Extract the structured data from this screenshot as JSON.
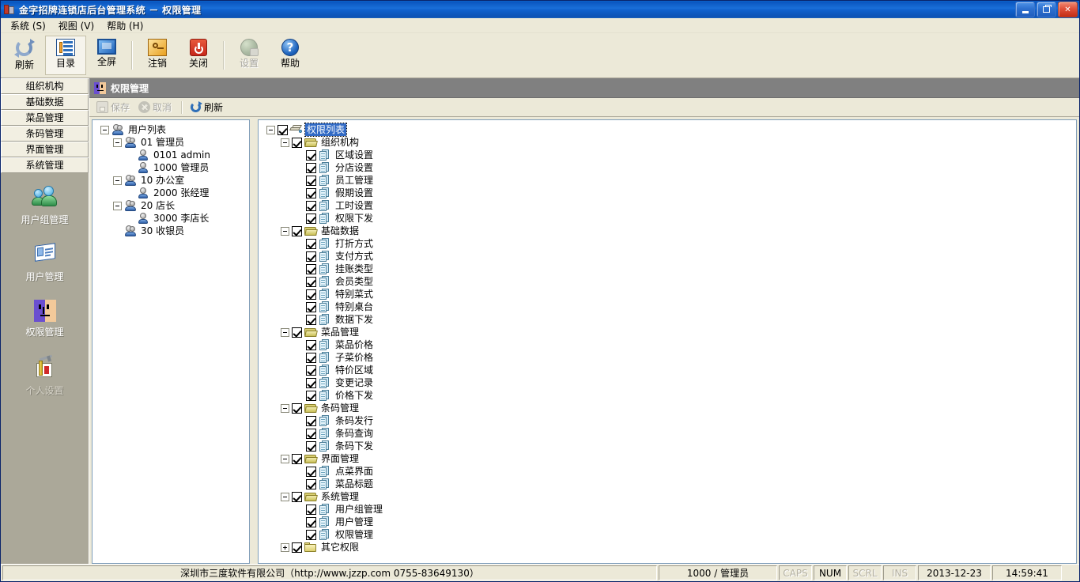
{
  "window": {
    "title": "金字招牌连锁店后台管理系统 － 权限管理",
    "icon": "app-database-icon",
    "minimize_label": "最小化",
    "restore_label": "还原",
    "close_label": "✕"
  },
  "menubar": {
    "items": [
      {
        "label": "系统 (S)"
      },
      {
        "label": "视图 (V)"
      },
      {
        "label": "帮助 (H)"
      }
    ]
  },
  "toolbar": {
    "buttons": [
      {
        "label": "刷新",
        "icon": "refresh-icon",
        "state": "normal"
      },
      {
        "label": "目录",
        "icon": "catalog-icon",
        "state": "active"
      },
      {
        "label": "全屏",
        "icon": "fullscreen-icon",
        "state": "normal"
      },
      {
        "label": "注销",
        "icon": "key-logout-icon",
        "state": "normal"
      },
      {
        "label": "关闭",
        "icon": "power-close-icon",
        "state": "normal"
      },
      {
        "label": "设置",
        "icon": "globe-settings-icon",
        "state": "disabled"
      },
      {
        "label": "帮助",
        "icon": "help-question-icon",
        "state": "normal"
      }
    ]
  },
  "sidebar": {
    "categories": [
      {
        "label": "组织机构"
      },
      {
        "label": "基础数据"
      },
      {
        "label": "菜品管理"
      },
      {
        "label": "条码管理"
      },
      {
        "label": "界面管理"
      },
      {
        "label": "系统管理"
      }
    ],
    "shortcuts": [
      {
        "label": "用户组管理",
        "icon": "users-group-icon"
      },
      {
        "label": "用户管理",
        "icon": "user-card-icon"
      },
      {
        "label": "权限管理",
        "icon": "permission-face-icon"
      },
      {
        "label": "个人设置",
        "icon": "personal-settings-icon"
      }
    ]
  },
  "content": {
    "header_title": "权限管理",
    "header_icon": "permission-face-icon",
    "actions": [
      {
        "label": "保存",
        "icon": "save-icon",
        "state": "disabled"
      },
      {
        "label": "取消",
        "icon": "cancel-icon",
        "state": "disabled"
      },
      {
        "label": "刷新",
        "icon": "refresh-icon",
        "state": "normal"
      }
    ]
  },
  "user_tree": {
    "root": {
      "label": "用户列表",
      "icon": "user-group-icon",
      "expanded": true
    },
    "nodes": [
      {
        "label": "01 管理员",
        "icon": "user-group-icon",
        "expanded": true,
        "depth": 1,
        "children": [
          {
            "label": "0101 admin",
            "icon": "user-icon",
            "depth": 2
          },
          {
            "label": "1000 管理员",
            "icon": "user-icon",
            "depth": 2
          }
        ]
      },
      {
        "label": "10 办公室",
        "icon": "user-group-icon",
        "expanded": true,
        "depth": 1,
        "children": [
          {
            "label": "2000 张经理",
            "icon": "user-icon",
            "depth": 2
          }
        ]
      },
      {
        "label": "20 店长",
        "icon": "user-group-icon",
        "expanded": true,
        "depth": 1,
        "children": [
          {
            "label": "3000 李店长",
            "icon": "user-icon",
            "depth": 2
          }
        ]
      },
      {
        "label": "30 收银员",
        "icon": "user-group-icon",
        "expanded": false,
        "depth": 1,
        "children": []
      }
    ]
  },
  "permission_tree": {
    "root": {
      "label": "权限列表",
      "icon": "permission-list-icon",
      "checked": true,
      "expanded": true,
      "selected": true
    },
    "groups": [
      {
        "label": "组织机构",
        "icon": "folder-open-icon",
        "checked": true,
        "expanded": true,
        "items": [
          {
            "label": "区域设置",
            "checked": true
          },
          {
            "label": "分店设置",
            "checked": true
          },
          {
            "label": "员工管理",
            "checked": true
          },
          {
            "label": "假期设置",
            "checked": true
          },
          {
            "label": "工时设置",
            "checked": true
          },
          {
            "label": "权限下发",
            "checked": true
          }
        ]
      },
      {
        "label": "基础数据",
        "icon": "folder-open-icon",
        "checked": true,
        "expanded": true,
        "items": [
          {
            "label": "打折方式",
            "checked": true
          },
          {
            "label": "支付方式",
            "checked": true
          },
          {
            "label": "挂账类型",
            "checked": true
          },
          {
            "label": "会员类型",
            "checked": true
          },
          {
            "label": "特别菜式",
            "checked": true
          },
          {
            "label": "特别桌台",
            "checked": true
          },
          {
            "label": "数据下发",
            "checked": true
          }
        ]
      },
      {
        "label": "菜品管理",
        "icon": "folder-open-icon",
        "checked": true,
        "expanded": true,
        "items": [
          {
            "label": "菜品价格",
            "checked": true
          },
          {
            "label": "子菜价格",
            "checked": true
          },
          {
            "label": "特价区域",
            "checked": true
          },
          {
            "label": "变更记录",
            "checked": true
          },
          {
            "label": "价格下发",
            "checked": true
          }
        ]
      },
      {
        "label": "条码管理",
        "icon": "folder-open-icon",
        "checked": true,
        "expanded": true,
        "items": [
          {
            "label": "条码发行",
            "checked": true
          },
          {
            "label": "条码查询",
            "checked": true
          },
          {
            "label": "条码下发",
            "checked": true
          }
        ]
      },
      {
        "label": "界面管理",
        "icon": "folder-open-icon",
        "checked": true,
        "expanded": true,
        "items": [
          {
            "label": "点菜界面",
            "checked": true
          },
          {
            "label": "菜品标题",
            "checked": true
          }
        ]
      },
      {
        "label": "系统管理",
        "icon": "folder-open-icon",
        "checked": true,
        "expanded": true,
        "items": [
          {
            "label": "用户组管理",
            "checked": true
          },
          {
            "label": "用户管理",
            "checked": true
          },
          {
            "label": "权限管理",
            "checked": true
          }
        ]
      },
      {
        "label": "其它权限",
        "icon": "folder-closed-icon",
        "checked": true,
        "expanded": false,
        "items": []
      }
    ]
  },
  "statusbar": {
    "company": "深圳市三度软件有限公司（http://www.jzzp.com  0755-83649130）",
    "user": "1000 / 管理员",
    "indicators": [
      {
        "label": "CAPS",
        "active": false
      },
      {
        "label": "NUM",
        "active": true
      },
      {
        "label": "SCRL",
        "active": false
      },
      {
        "label": "INS",
        "active": false
      }
    ],
    "date": "2013-12-23",
    "time": "14:59:41"
  },
  "colors": {
    "title_blue": "#0a56c0",
    "header_gray": "#808080",
    "selection_blue": "#316ac5",
    "sidebar_gray": "#aba899",
    "face_bg": "#ece9d8"
  }
}
